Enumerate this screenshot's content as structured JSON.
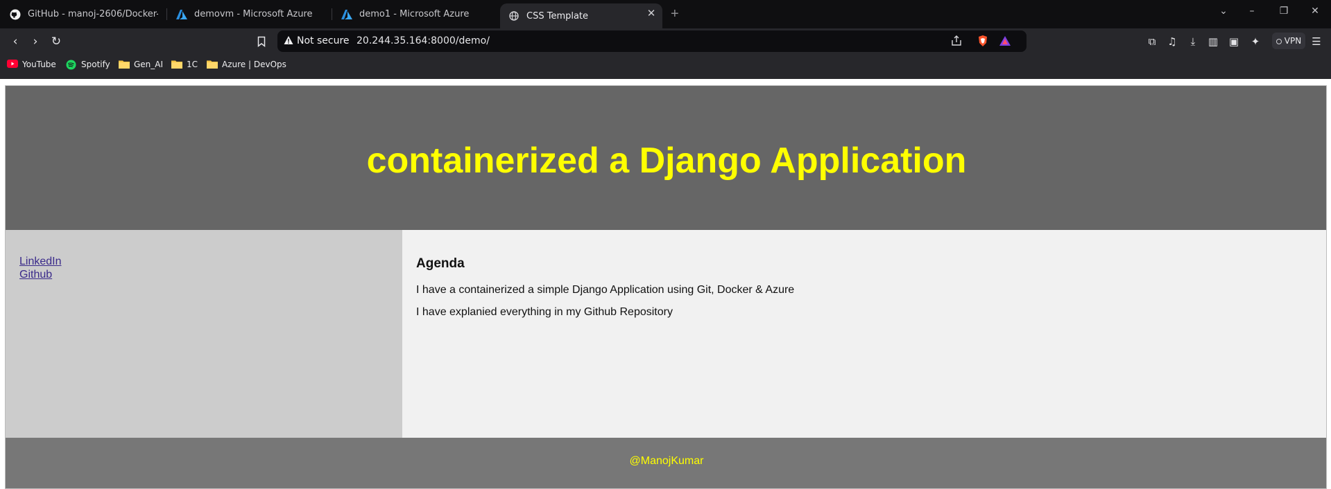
{
  "browser": {
    "tabs": [
      {
        "title": "GitHub - manoj-2606/Docker-Zero-",
        "icon": "github-icon"
      },
      {
        "title": "demovm - Microsoft Azure",
        "icon": "azure-icon"
      },
      {
        "title": "demo1 - Microsoft Azure",
        "icon": "azure-icon"
      },
      {
        "title": "CSS Template",
        "icon": "globe-icon",
        "active": true
      }
    ],
    "new_tab_glyph": "+",
    "security_label": "Not secure",
    "url": "20.244.35.164:8000/demo/",
    "vpn_label": "VPN",
    "bookmarks": [
      {
        "label": "YouTube",
        "icon": "youtube-icon"
      },
      {
        "label": "Spotify",
        "icon": "spotify-icon"
      },
      {
        "label": "Gen_AI",
        "icon": "folder-icon"
      },
      {
        "label": "1C",
        "icon": "folder-icon"
      },
      {
        "label": "Azure | DevOps",
        "icon": "folder-icon"
      }
    ]
  },
  "page": {
    "header_title": "containerized a Django Application",
    "nav_links": [
      "LinkedIn",
      "Github"
    ],
    "article": {
      "heading": "Agenda",
      "paragraphs": [
        "I have a containerized a simple Django Application using Git, Docker & Azure",
        "I have explanied everything in my Github Repository"
      ]
    },
    "footer_text": "@ManojKumar"
  },
  "colors": {
    "header_bg": "#666666",
    "title_color": "#ffff00",
    "nav_bg": "#cccccc",
    "article_bg": "#f1f1f1",
    "footer_bg": "#777777",
    "footer_text": "#ffff00",
    "browser_dark": "#0f0f11",
    "browser_toolbar": "#27272b"
  }
}
